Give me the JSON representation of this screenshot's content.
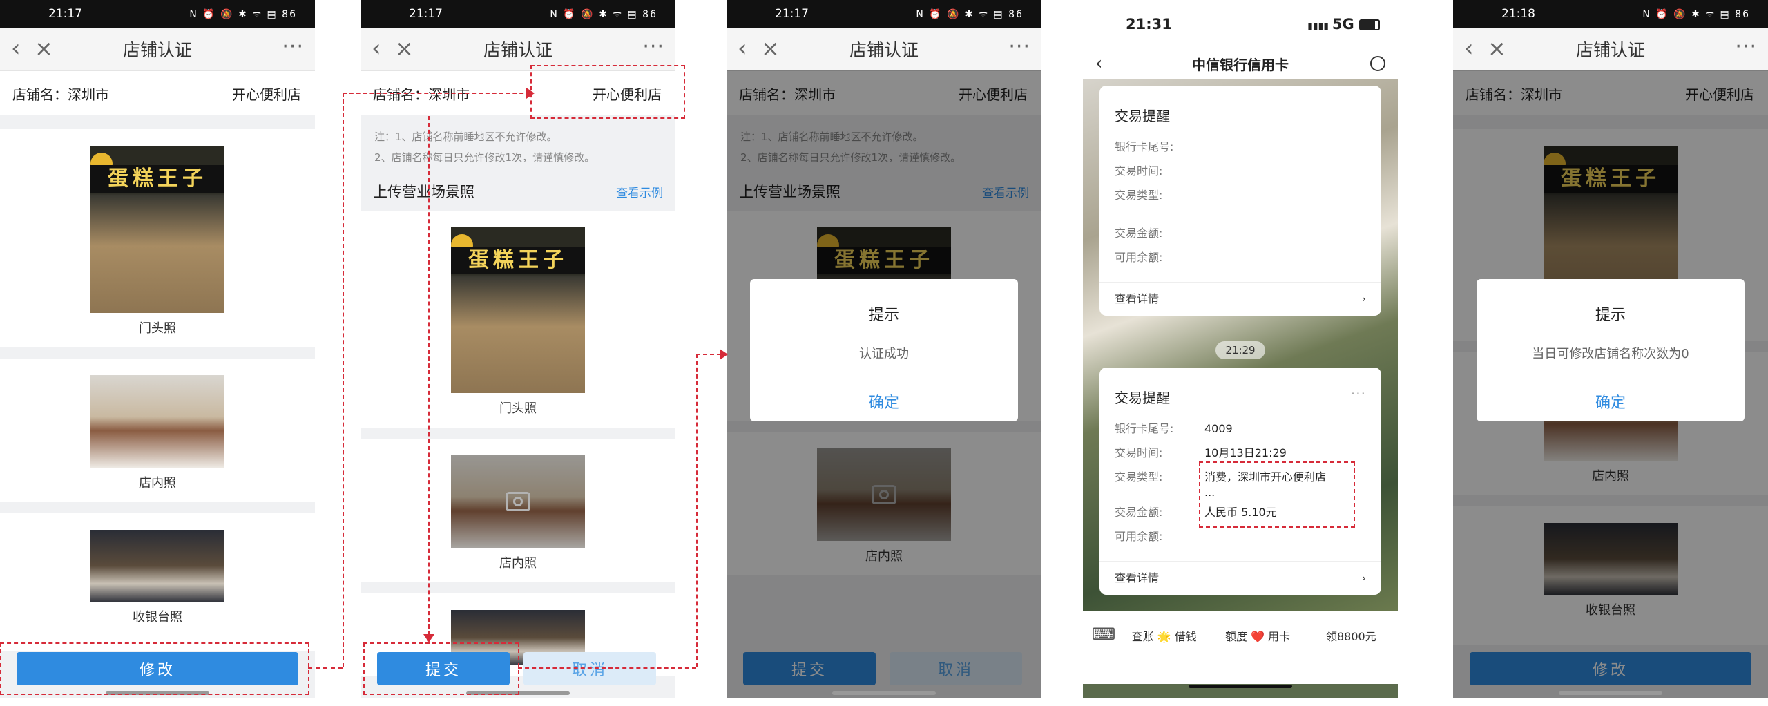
{
  "screens": {
    "s1": {
      "status_time": "21:17",
      "status_icons": "N ⏰ 🔕 ✱ ᯤ ▤ 86",
      "nav_title": "店铺认证",
      "shop_label": "店铺名：深圳市",
      "shop_value": "开心便利店",
      "photo_front_caption": "门头照",
      "photo_inner_caption": "店内照",
      "photo_counter_caption": "收银台照",
      "button": "修改"
    },
    "s2": {
      "status_time": "21:17",
      "status_icons": "N ⏰ 🔕 ✱ ᯤ ▤ 86",
      "nav_title": "店铺认证",
      "shop_label": "店铺名：深圳市",
      "shop_value": "开心便利店",
      "note1": "注：1、店铺名称前睡地区不允许修改。",
      "note2": "2、店铺名称每日只允许修改1次，请谨慎修改。",
      "section": "上传营业场景照",
      "example_link": "查看示例",
      "photo_front_caption": "门头照",
      "photo_inner_caption": "店内照",
      "submit": "提交",
      "cancel": "取消"
    },
    "s3": {
      "status_time": "21:17",
      "status_icons": "N ⏰ 🔕 ✱ ᯤ ▤ 86",
      "nav_title": "店铺认证",
      "shop_label": "店铺名：深圳市",
      "shop_value": "开心便利店",
      "note1": "注：1、店铺名称前睡地区不允许修改。",
      "note2": "2、店铺名称每日只允许修改1次，请谨慎修改。",
      "section": "上传营业场景照",
      "example_link": "查看示例",
      "photo_inner_caption": "店内照",
      "dialog_title": "提示",
      "dialog_message": "认证成功",
      "dialog_ok": "确定",
      "submit": "提交",
      "cancel": "取消"
    },
    "s4": {
      "status_time": "21:31",
      "status_network": "5G",
      "nav_title": "中信银行信用卡",
      "card1": {
        "title": "交易提醒",
        "rows": [
          {
            "k": "银行卡尾号:",
            "v": ""
          },
          {
            "k": "交易时间:",
            "v": ""
          },
          {
            "k": "交易类型:",
            "v": ""
          },
          {
            "k": "交易金额:",
            "v": ""
          },
          {
            "k": "可用余额:",
            "v": ""
          }
        ],
        "detail": "查看详情"
      },
      "time_pill": "21:29",
      "card2": {
        "title": "交易提醒",
        "rows": [
          {
            "k": "银行卡尾号:",
            "v": "4009"
          },
          {
            "k": "交易时间:",
            "v": "10月13日21:29"
          },
          {
            "k": "交易类型:",
            "v": "消费，深圳市开心便利店 ..."
          },
          {
            "k": "交易金额:",
            "v": "人民币 5.10元"
          },
          {
            "k": "可用余额:",
            "v": ""
          }
        ],
        "detail": "查看详情"
      },
      "tabs": [
        "查账 🌟 借钱",
        "额度 ❤️ 用卡",
        "领8800元"
      ]
    },
    "s5": {
      "status_time": "21:18",
      "status_icons": "N ⏰ 🔕 ✱ ᯤ ▤ 86",
      "nav_title": "店铺认证",
      "shop_label": "店铺名：深圳市",
      "shop_value": "开心便利店",
      "photo_inner_caption": "店内照",
      "photo_counter_caption": "收银台照",
      "dialog_title": "提示",
      "dialog_message": "当日可修改店铺名称次数为0",
      "dialog_ok": "确定",
      "button": "修改"
    }
  },
  "photo_sign_text": "蛋糕王子",
  "colors": {
    "accent": "#2f8be0",
    "annotation": "#d62b39"
  }
}
